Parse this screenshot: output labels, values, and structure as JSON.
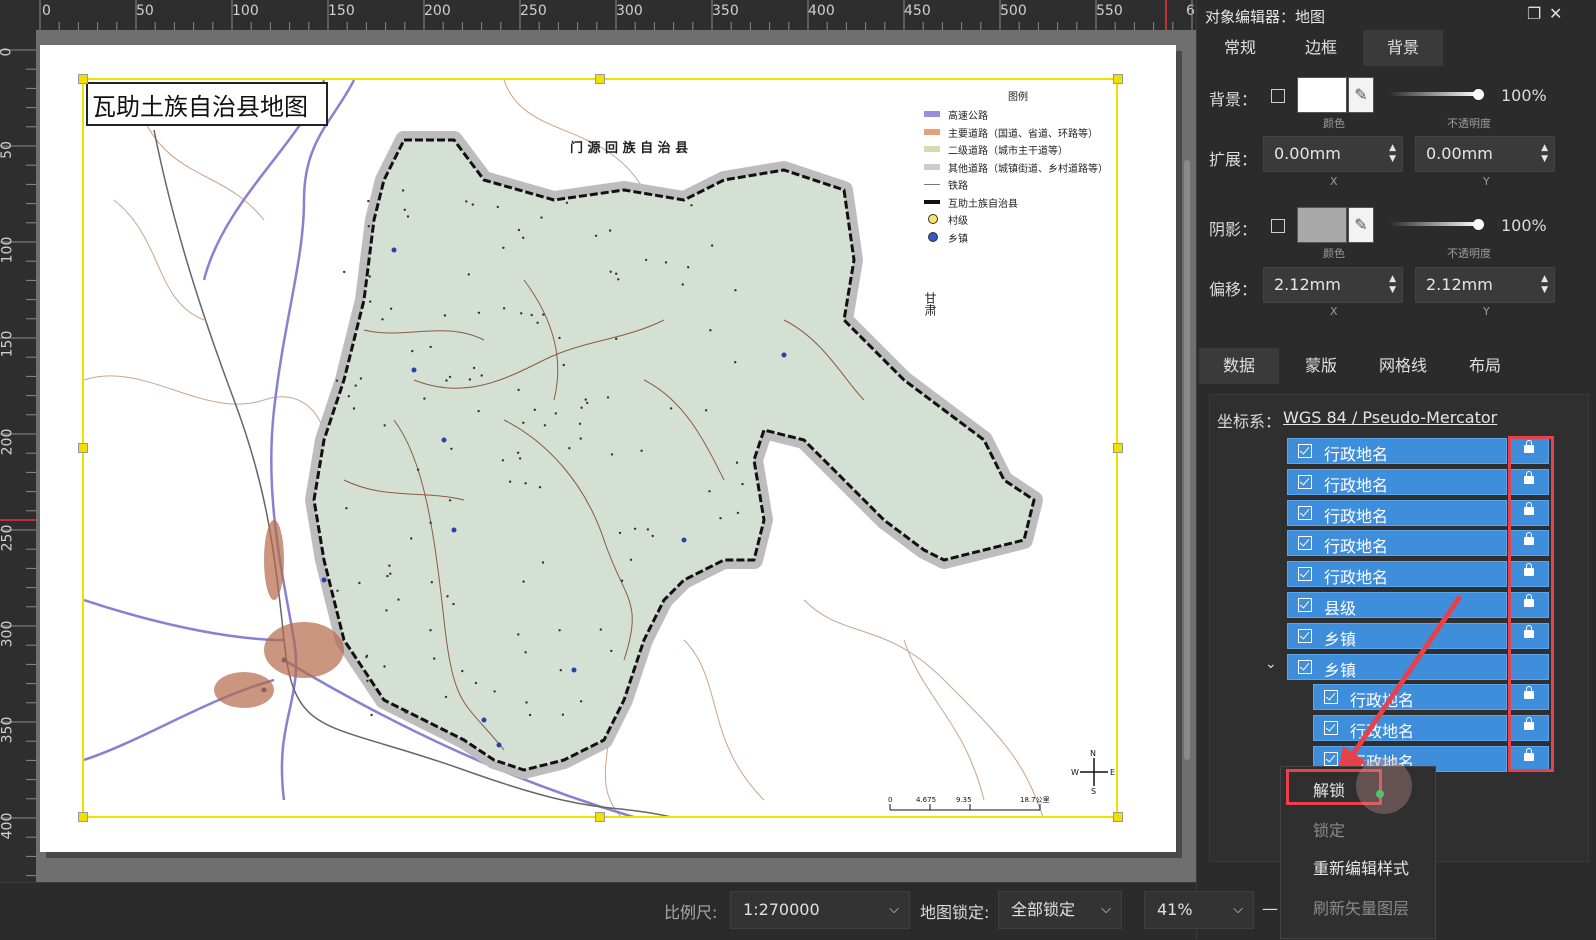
{
  "ruler": {
    "top_ticks": [
      "0",
      "50",
      "100",
      "150",
      "200",
      "250",
      "300",
      "350",
      "400",
      "450",
      "500",
      "550",
      "6"
    ],
    "left_ticks": [
      "0",
      "50",
      "100",
      "150",
      "200",
      "250",
      "300",
      "350",
      "400"
    ]
  },
  "map": {
    "title": "瓦助土族自治县地图",
    "labels": {
      "north_county": "门 源 回 族 自 治 县",
      "gansu": "甘肃",
      "scale_ticks": [
        "0",
        "4.675",
        "9.35",
        "18.7公里"
      ],
      "compass_n": "N",
      "compass_e": "E",
      "compass_s": "S",
      "compass_w": "W"
    },
    "legend": {
      "title": "图例",
      "items": [
        {
          "label": "高速公路",
          "color": "#9a8fd6"
        },
        {
          "label": "主要道路（国道、省道、环路等）",
          "color": "#e8a07a"
        },
        {
          "label": "二级道路（城市主干道等）",
          "color": "#d9d9b0"
        },
        {
          "label": "其他道路（城镇街道、乡村道路等）",
          "color": "#cccccc"
        },
        {
          "label": "铁路",
          "color": "#777777"
        },
        {
          "label": "互助土族自治县",
          "color": "#111111"
        },
        {
          "label": "村级",
          "color": "#f5e663"
        },
        {
          "label": "乡镇",
          "color": "#3457c9"
        }
      ]
    }
  },
  "panel": {
    "title": "对象编辑器：地图",
    "tabs_top": [
      "常规",
      "边框",
      "背景"
    ],
    "active_top_tab": "背景",
    "background": {
      "label": "背景：",
      "color_caption": "颜色",
      "opacity": "100%",
      "opacity_caption": "不透明度"
    },
    "extend": {
      "label": "扩展：",
      "x": "0.00mm",
      "y": "0.00mm",
      "x_caption": "X",
      "y_caption": "Y"
    },
    "shadow": {
      "label": "阴影：",
      "color_caption": "颜色",
      "opacity": "100%",
      "opacity_caption": "不透明度"
    },
    "offset": {
      "label": "偏移：",
      "x": "2.12mm",
      "y": "2.12mm",
      "x_caption": "X",
      "y_caption": "Y"
    },
    "tabs_bottom": [
      "数据",
      "蒙版",
      "网格线",
      "布局"
    ],
    "active_bottom_tab": "数据",
    "crs_label": "坐标系：",
    "crs_value": "WGS 84 / Pseudo-Mercator",
    "layers": [
      {
        "name": "行政地名",
        "indent": 0,
        "locked": true
      },
      {
        "name": "行政地名",
        "indent": 0,
        "locked": true
      },
      {
        "name": "行政地名",
        "indent": 0,
        "locked": true
      },
      {
        "name": "行政地名",
        "indent": 0,
        "locked": true
      },
      {
        "name": "行政地名",
        "indent": 0,
        "locked": true
      },
      {
        "name": "县级",
        "indent": 0,
        "locked": true
      },
      {
        "name": "乡镇",
        "indent": 0,
        "locked": true
      },
      {
        "name": "乡镇",
        "indent": 0,
        "locked": false,
        "group": true
      },
      {
        "name": "行政地名",
        "indent": 1,
        "locked": true
      },
      {
        "name": "行政地名",
        "indent": 1,
        "locked": true
      },
      {
        "name": "行政地名",
        "indent": 1,
        "locked": true
      }
    ],
    "context_menu": [
      {
        "label": "解锁",
        "enabled": true
      },
      {
        "label": "锁定",
        "enabled": false
      },
      {
        "label": "重新编辑样式",
        "enabled": true
      },
      {
        "label": "刷新矢量图层",
        "enabled": false
      }
    ]
  },
  "statusbar": {
    "scale_label": "比例尺:",
    "scale_value": "1:270000",
    "lock_label": "地图锁定:",
    "lock_value": "全部锁定",
    "zoom_value": "41%",
    "minus": "—"
  },
  "colors": {
    "accent_blue": "#3e8edb",
    "highlight_red": "#e8414a",
    "county_fill": "#d6e2d6",
    "frame_yellow": "#f0e000"
  }
}
